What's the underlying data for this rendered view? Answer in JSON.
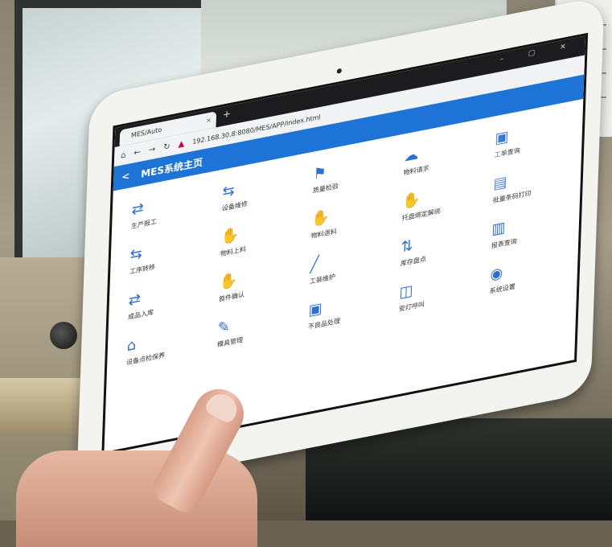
{
  "browser": {
    "tab_title": "MES/Auto",
    "close_glyph": "×",
    "new_tab_glyph": "+",
    "window_controls": "– ▢ ✕",
    "url": "192.168.30.8:8080/MES/APP/Index.html"
  },
  "app": {
    "back_glyph": "<",
    "title": "MES系统主页"
  },
  "menu": [
    {
      "icon": "⇄",
      "label": "生产报工"
    },
    {
      "icon": "⇆",
      "label": "设备维修"
    },
    {
      "icon": "⚑",
      "label": "质量检验"
    },
    {
      "icon": "☁",
      "label": "物料请求"
    },
    {
      "icon": "▣",
      "label": "工单查询"
    },
    {
      "icon": "⇆",
      "label": "工序转移"
    },
    {
      "icon": "✋",
      "label": "物料上料"
    },
    {
      "icon": "✋",
      "label": "物料退料"
    },
    {
      "icon": "✋",
      "label": "托盘绑定解绑"
    },
    {
      "icon": "▤",
      "label": "批量条码打印"
    },
    {
      "icon": "⇄",
      "label": "成品入库"
    },
    {
      "icon": "✋",
      "label": "首件确认"
    },
    {
      "icon": "╱",
      "label": "工装维护"
    },
    {
      "icon": "⇅",
      "label": "库存盘点"
    },
    {
      "icon": "▥",
      "label": "报表查询"
    },
    {
      "icon": "⌂",
      "label": "设备点检保养"
    },
    {
      "icon": "✎",
      "label": "模具管理"
    },
    {
      "icon": "▣",
      "label": "不良品处理"
    },
    {
      "icon": "◫",
      "label": "安灯呼叫"
    },
    {
      "icon": "◉",
      "label": "系统设置"
    }
  ]
}
